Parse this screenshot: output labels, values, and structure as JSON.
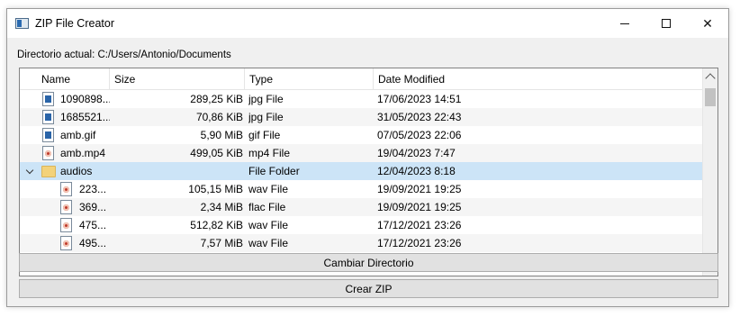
{
  "window": {
    "title": "ZIP File Creator"
  },
  "current_directory": {
    "text": "Directorio actual: C:/Users/Antonio/Documents"
  },
  "columns": [
    "Name",
    "Size",
    "Type",
    "Date Modified"
  ],
  "rows": [
    {
      "name": "1090898...",
      "size": "289,25 KiB",
      "type": "jpg File",
      "date": "17/06/2023 14:51",
      "icon": "image-file-icon"
    },
    {
      "name": "1685521...",
      "size": "70,86 KiB",
      "type": "jpg File",
      "date": "31/05/2023 22:43",
      "icon": "image-file-icon"
    },
    {
      "name": "amb.gif",
      "size": "5,90 MiB",
      "type": "gif File",
      "date": "07/05/2023 22:06",
      "icon": "image-file-icon"
    },
    {
      "name": "amb.mp4",
      "size": "499,05 KiB",
      "type": "mp4 File",
      "date": "19/04/2023 7:47",
      "icon": "media-file-icon"
    },
    {
      "name": "audios",
      "size": "",
      "type": "File Folder",
      "date": "12/04/2023 8:18",
      "icon": "folder-icon"
    },
    {
      "name": "223...",
      "size": "105,15 MiB",
      "type": "wav File",
      "date": "19/09/2021 19:25",
      "icon": "audio-file-icon"
    },
    {
      "name": "369...",
      "size": "2,34 MiB",
      "type": "flac File",
      "date": "19/09/2021 19:25",
      "icon": "audio-file-icon"
    },
    {
      "name": "475...",
      "size": "512,82 KiB",
      "type": "wav File",
      "date": "17/12/2021 23:26",
      "icon": "audio-file-icon"
    },
    {
      "name": "495...",
      "size": "7,57 MiB",
      "type": "wav File",
      "date": "17/12/2021 23:26",
      "icon": "audio-file-icon"
    }
  ],
  "buttons": {
    "change_dir": "Cambiar Directorio",
    "create_zip": "Crear ZIP"
  },
  "colors": {
    "selection": "#cce4f7",
    "folder": "#f3d27a"
  }
}
